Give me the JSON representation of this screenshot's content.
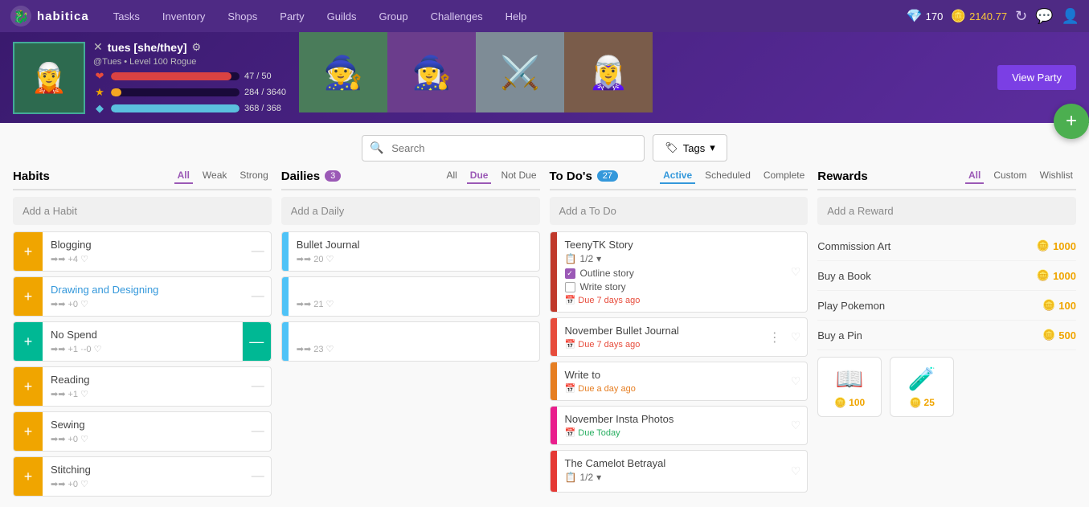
{
  "nav": {
    "logo_text": "habitica",
    "links": [
      "Tasks",
      "Inventory",
      "Shops",
      "Party",
      "Guilds",
      "Group",
      "Challenges",
      "Help"
    ],
    "gem_count": "170",
    "gold_count": "2140.77"
  },
  "player": {
    "name": "tues [she/they]",
    "handle": "@Tues • Level 100 Rogue",
    "hp": "47 / 50",
    "xp": "284 / 3640",
    "mp": "368 / 368",
    "hp_pct": "94",
    "xp_pct": "8",
    "mp_pct": "100"
  },
  "party": {
    "view_btn": "View Party",
    "avatars": [
      "🧙",
      "🧙‍♀️",
      "⚔️",
      "🧝"
    ]
  },
  "search": {
    "placeholder": "Search",
    "tags_label": "Tags"
  },
  "habits": {
    "title": "Habits",
    "filters": [
      "All",
      "Weak",
      "Strong"
    ],
    "active_filter": "All",
    "add_label": "Add a Habit",
    "items": [
      {
        "name": "Blogging",
        "meta": "➡➡ +4 ♡",
        "style": "normal"
      },
      {
        "name": "Drawing and Designing",
        "meta": "➡➡ +0 ♡",
        "style": "normal"
      },
      {
        "name": "No Spend",
        "meta": "➡➡ +1 ·-0 ♡",
        "style": "teal"
      },
      {
        "name": "Reading",
        "meta": "➡➡ +1 ♡",
        "style": "normal"
      },
      {
        "name": "Sewing",
        "meta": "➡➡ +0 ♡",
        "style": "normal"
      },
      {
        "name": "Stitching",
        "meta": "➡➡ +0 ♡",
        "style": "normal"
      }
    ]
  },
  "dailies": {
    "title": "Dailies",
    "badge": "3",
    "filters": [
      "All",
      "Due",
      "Not Due"
    ],
    "active_filter": "Due",
    "add_label": "Add a Daily",
    "items": [
      {
        "name": "Bullet Journal",
        "meta": "➡➡ 20 ♡"
      },
      {
        "name": "",
        "meta": "➡➡ 21 ♡"
      },
      {
        "name": "",
        "meta": "➡➡ 23 ♡"
      }
    ]
  },
  "todos": {
    "title": "To Do's",
    "badge": "27",
    "filters": [
      "Active",
      "Scheduled",
      "Complete"
    ],
    "active_filter": "Active",
    "add_label": "Add a To Do",
    "items": [
      {
        "name": "TeenyTK Story",
        "color": "red-dark",
        "subtask_label": "1/2",
        "subtasks": [
          {
            "label": "Outline story",
            "checked": true
          },
          {
            "label": "Write story",
            "checked": false
          }
        ],
        "due": "Due 7 days ago",
        "due_color": "red"
      },
      {
        "name": "November Bullet Journal",
        "color": "red",
        "due": "Due 7 days ago",
        "due_color": "red"
      },
      {
        "name": "Write to",
        "color": "orange",
        "due": "Due a day ago",
        "due_color": "orange"
      },
      {
        "name": "November Insta Photos",
        "color": "pink",
        "due": "Due Today",
        "due_color": "green"
      },
      {
        "name": "The Camelot Betrayal",
        "color": "red2",
        "subtask_label": "1/2"
      }
    ]
  },
  "rewards": {
    "title": "Rewards",
    "filters": [
      "All",
      "Custom",
      "Wishlist"
    ],
    "active_filter": "All",
    "add_label": "Add a Reward",
    "items": [
      {
        "name": "Commission Art",
        "cost": "1000"
      },
      {
        "name": "Buy a Book",
        "cost": "1000"
      },
      {
        "name": "Play Pokemon",
        "cost": "100"
      },
      {
        "name": "Buy a Pin",
        "cost": "500"
      }
    ],
    "cards": [
      {
        "icon": "📖",
        "cost": "100"
      },
      {
        "icon": "🧪",
        "cost": "25"
      }
    ]
  }
}
